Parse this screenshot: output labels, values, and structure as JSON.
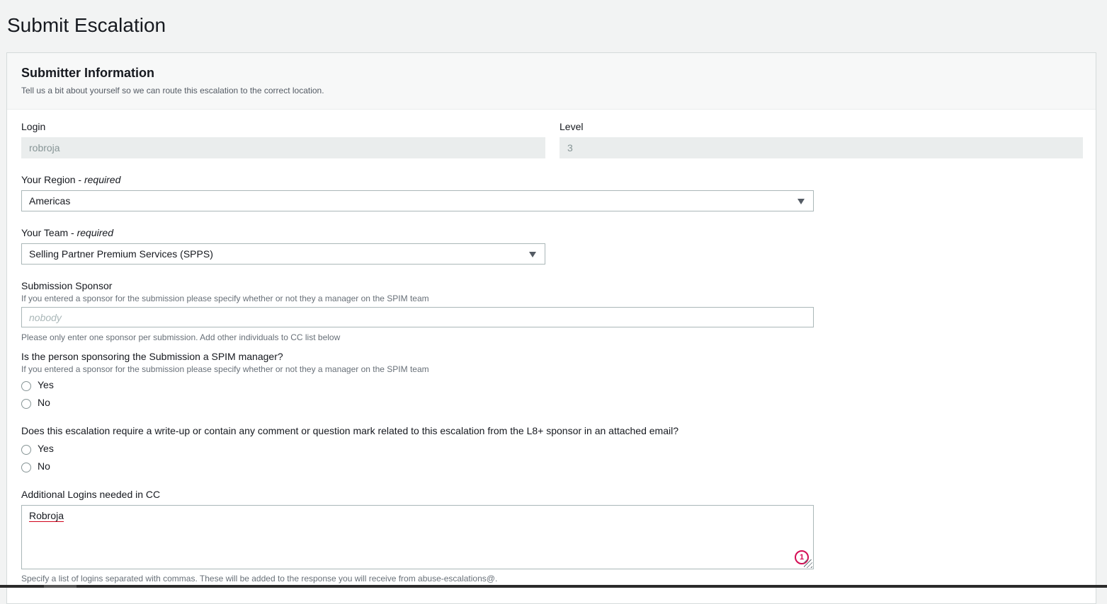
{
  "page": {
    "title": "Submit Escalation"
  },
  "section": {
    "title": "Submitter Information",
    "description": "Tell us a bit about yourself so we can route this escalation to the correct location."
  },
  "login": {
    "label": "Login",
    "value": "robroja"
  },
  "level": {
    "label": "Level",
    "value": "3"
  },
  "region": {
    "label": "Your Region - ",
    "required": "required",
    "value": "Americas"
  },
  "team": {
    "label": "Your Team - ",
    "required": "required",
    "value": "Selling Partner Premium Services (SPPS)"
  },
  "sponsor": {
    "label": "Submission Sponsor",
    "help": "If you entered a sponsor for the submission please specify whether or not they a manager on the SPIM team",
    "placeholder": "nobody",
    "note": "Please only enter one sponsor per submission. Add other individuals to CC list below"
  },
  "spim_manager": {
    "question": "Is the person sponsoring the Submission a SPIM manager?",
    "help": "If you entered a sponsor for the submission please specify whether or not they a manager on the SPIM team",
    "options": [
      "Yes",
      "No"
    ]
  },
  "writeup": {
    "question": "Does this escalation require a write-up or contain any comment or question mark related to this escalation from the L8+ sponsor in an attached email?",
    "options": [
      "Yes",
      "No"
    ]
  },
  "cc": {
    "label": "Additional Logins needed in CC",
    "value": "Robroja",
    "badge": "1",
    "help": "Specify a list of logins separated with commas. These will be added to the response you will receive from abuse-escalations@."
  },
  "colors": {
    "error_accent": "#d40c53",
    "disabled_bg": "#eaeded",
    "panel_header_bg": "#f7f8f8"
  }
}
